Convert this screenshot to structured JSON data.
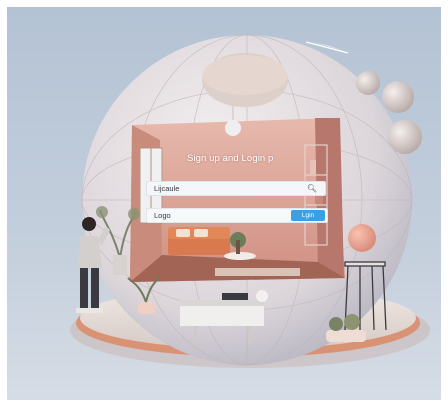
{
  "page": {
    "title": "Sign up and Login p"
  },
  "search_field": {
    "value": "Lijcaule",
    "icon": "search-icon"
  },
  "login_field": {
    "value": "Logo",
    "button_label": "Lgin"
  },
  "colors": {
    "accent": "#3aa0e4",
    "background": "#b9c7d7",
    "sphere_interior": "#dca99d",
    "floor_accent": "#d99374"
  }
}
